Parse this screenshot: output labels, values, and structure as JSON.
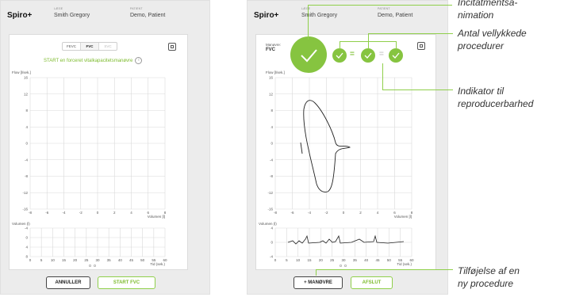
{
  "app_name": "Spiro+",
  "header": {
    "doctor_label": "LÆGE",
    "doctor_name": "Smith Gregory",
    "patient_label": "PATIENT",
    "patient_name": "Demo, Patient"
  },
  "left": {
    "tabs": [
      "FEVC",
      "FVC",
      "SVC"
    ],
    "active_tab": "FVC",
    "instruction": "START en forceret vitalkapacitetsmanøvre",
    "flow_label": "Flow [l/sek.]",
    "flow_ticks": [
      "16",
      "12",
      "8",
      "4",
      "0",
      "-4",
      "-8",
      "-12",
      "-16"
    ],
    "volume_ticks": [
      "-8",
      "-6",
      "-4",
      "-2",
      "0",
      "2",
      "4",
      "6",
      "8"
    ],
    "volume_axis_label": "Volumen [l]",
    "vt_label": "Volumen (l)",
    "vt_ticks": [
      "-4",
      "0",
      "4",
      "8"
    ],
    "time_ticks": [
      "0",
      "5",
      "10",
      "15",
      "20",
      "25",
      "30",
      "35",
      "40",
      "45",
      "50",
      "55",
      "60"
    ],
    "time_label": "Tid (sek.)",
    "cancel_button": "ANNULLER",
    "start_button": "START FVC"
  },
  "right": {
    "maneuver_label": "Manøvre:",
    "maneuver_value": "FVC",
    "flow_label": "Flow [l/sek.]",
    "flow_ticks": [
      "16",
      "12",
      "8",
      "4",
      "0",
      "-4",
      "-8",
      "-12",
      "-16"
    ],
    "volume_ticks": [
      "-8",
      "-6",
      "-4",
      "-2",
      "0",
      "2",
      "4",
      "6",
      "8"
    ],
    "volume_axis_label": "Volumen [l]",
    "vt_label": "Volumen (l)",
    "vt_ticks": [
      "4",
      "0",
      "-4"
    ],
    "time_ticks": [
      "0",
      "5",
      "10",
      "15",
      "20",
      "25",
      "30",
      "35",
      "40",
      "45",
      "50",
      "55",
      "60"
    ],
    "time_label": "Tid (sek.)",
    "add_button": "+ MANØVRE",
    "finish_button": "AFSLUT",
    "equals": "="
  },
  "annotations": {
    "incentive": "Incitatmentsa-\nnimation",
    "count": "Antal vellykkede\nprocedurer",
    "reproducibility": "Indikator til\nreproducerbarhed",
    "add_procedure": "Tilføjelse af en\nny procedure"
  },
  "colors": {
    "accent": "#86c440",
    "text": "#333333"
  }
}
